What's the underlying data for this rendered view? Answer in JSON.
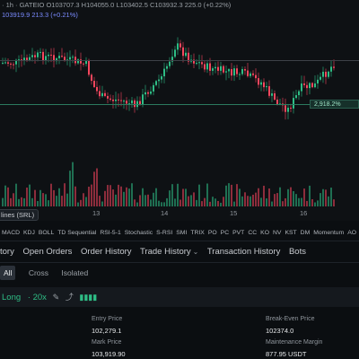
{
  "ohlc": {
    "text": "· 1h · GATEIO  O103707.3  H104055.0  L103402.5  C103932.3  225.0 (+0.22%)",
    "ma": "103919.9  213.3  (+0.21%)"
  },
  "price_tag": "2,918.2%",
  "x_axis": {
    "labels": [
      "13",
      "14",
      "15",
      "16"
    ],
    "series_tag": "lines (SRL)"
  },
  "indicators": [
    "MACD",
    "KDJ",
    "BOLL",
    "TD Sequential",
    "RSI-5-1",
    "Stochastic",
    "S-RSI",
    "SMI",
    "TRIX",
    "PO",
    "PC",
    "PVT",
    "CC",
    "KO",
    "NV",
    "KST",
    "DM",
    "Momentum",
    "AO",
    "HV",
    "Rate",
    "CCI"
  ],
  "tabs": [
    {
      "label": "tory"
    },
    {
      "label": "Open Orders"
    },
    {
      "label": "Order History"
    },
    {
      "label": "Trade History"
    },
    {
      "label": "Transaction History"
    },
    {
      "label": "Bots"
    }
  ],
  "subtabs": {
    "all": "All",
    "cross": "Cross",
    "isolated": "Isolated"
  },
  "position": {
    "side": "Long",
    "leverage": "20x",
    "entry_price_label": "Entry Price",
    "entry_price": "102,279.1",
    "mark_price_label": "Mark Price",
    "mark_price": "103,919.90",
    "break_even_label": "Break-Even Price",
    "break_even": "102374.0",
    "maint_margin_label": "Maintenance Margin",
    "maint_margin": "877.95 USDT"
  },
  "colors": {
    "up": "#2ebd85",
    "down": "#f6465d",
    "accent": "#f0b90b"
  },
  "icons": [
    "edit-icon",
    "share-icon",
    "signal-bars-icon",
    "chevron-down-icon"
  ]
}
